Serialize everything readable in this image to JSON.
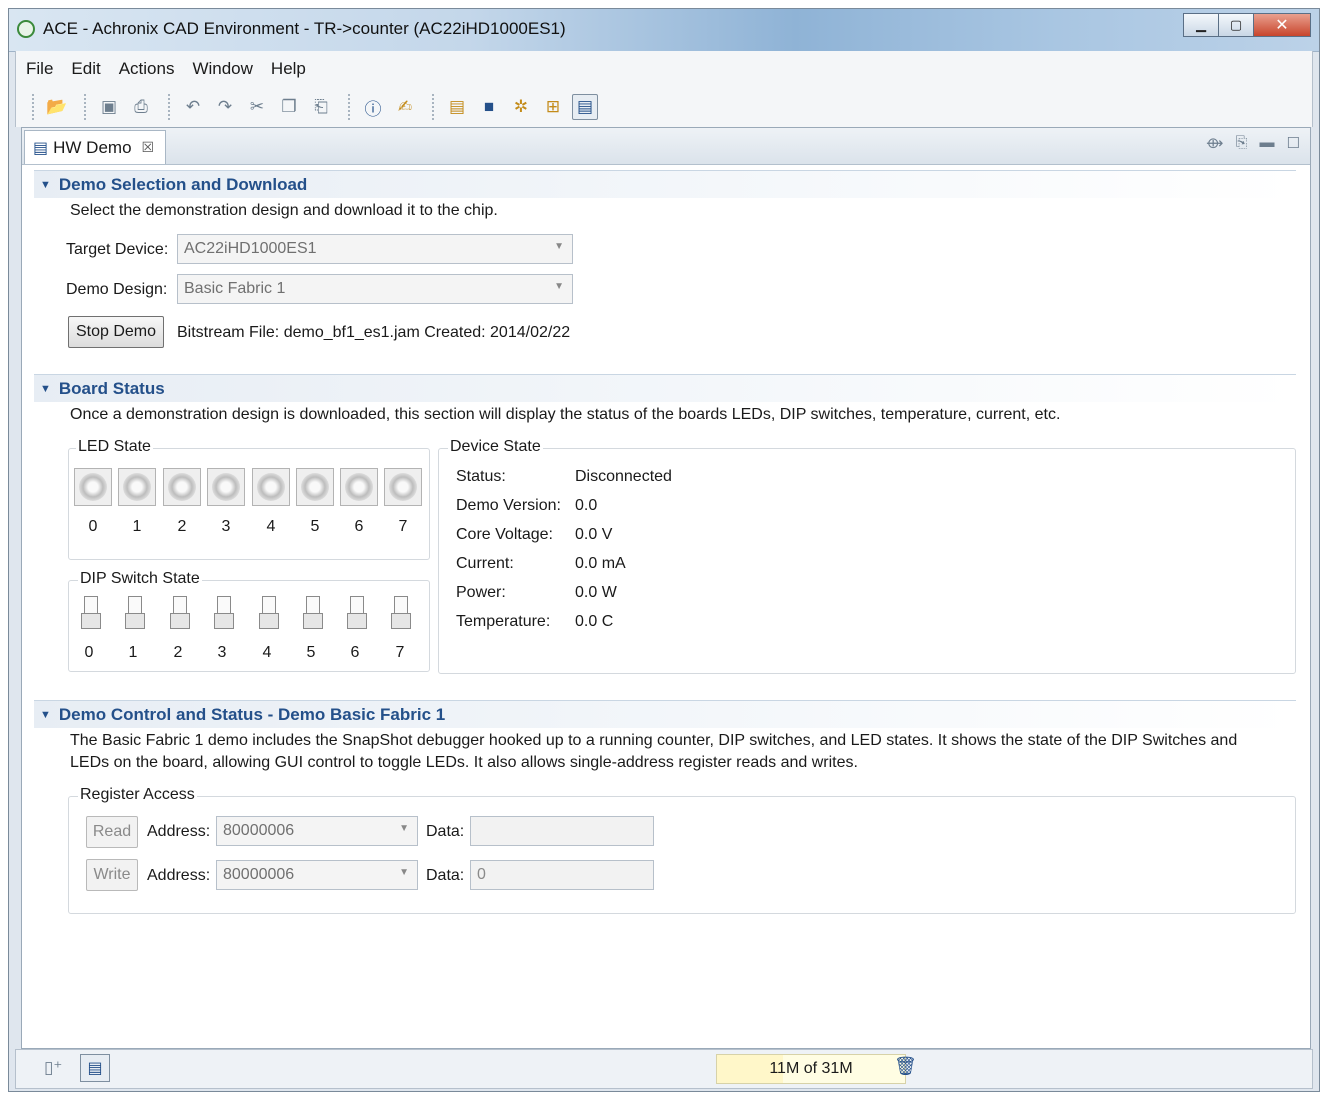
{
  "window": {
    "title": "ACE - Achronix CAD Environment - TR->counter (AC22iHD1000ES1)",
    "minimize": "▁",
    "maximize": "▢",
    "close": "✕"
  },
  "menu": [
    "File",
    "Edit",
    "Actions",
    "Window",
    "Help"
  ],
  "toolbar_icons": [
    "open-folder-icon",
    "save-icon",
    "print-icon",
    "undo-icon",
    "redo-icon",
    "cut-icon",
    "copy-icon",
    "paste-icon",
    "help-icon",
    "cheat-sheet-icon",
    "project-icon",
    "chip-icon",
    "gear-icon",
    "flow-icon",
    "hw-demo-icon"
  ],
  "view": {
    "tab_label": "HW Demo",
    "tab_close": "☒"
  },
  "demo_selection": {
    "title": "Demo Selection and Download",
    "description": "Select the demonstration design and download it to the chip.",
    "target_device_label": "Target Device:",
    "target_device_value": "AC22iHD1000ES1",
    "demo_design_label": "Demo Design:",
    "demo_design_value": "Basic Fabric 1",
    "stop_button": "Stop Demo",
    "bitstream_info": "Bitstream File: demo_bf1_es1.jam  Created: 2014/02/22"
  },
  "board_status": {
    "title": "Board Status",
    "description": "Once a demonstration design is downloaded, this section will display the status of the boards LEDs, DIP switches, temperature, current, etc.",
    "led_group_label": "LED State",
    "led_numbers": [
      "0",
      "1",
      "2",
      "3",
      "4",
      "5",
      "6",
      "7"
    ],
    "dip_group_label": "DIP Switch State",
    "dip_numbers": [
      "0",
      "1",
      "2",
      "3",
      "4",
      "5",
      "6",
      "7"
    ],
    "device_group_label": "Device State",
    "device_rows": [
      {
        "label": "Status:",
        "value": "Disconnected"
      },
      {
        "label": "Demo Version:",
        "value": "0.0"
      },
      {
        "label": "Core Voltage:",
        "value": "0.0 V"
      },
      {
        "label": "Current:",
        "value": "0.0 mA"
      },
      {
        "label": "Power:",
        "value": "0.0 W"
      },
      {
        "label": "Temperature:",
        "value": "0.0 C"
      }
    ]
  },
  "demo_control": {
    "title": "Demo Control and Status - Demo Basic Fabric 1",
    "description_line1": "The Basic Fabric 1 demo includes the SnapShot debugger hooked up to a running counter, DIP switches, and LED states.  It shows the state of the DIP Switches and",
    "description_line2": "LEDs on the board, allowing GUI control to toggle LEDs.  It also allows single-address register reads and writes.",
    "register_group_label": "Register Access",
    "read_button": "Read",
    "write_button": "Write",
    "address_label": "Address:",
    "data_label": "Data:",
    "read_address": "80000006",
    "read_data": "",
    "write_address": "80000006",
    "write_data": "0"
  },
  "status": {
    "heap": "11M of 31M",
    "heap_used_fraction": 0.35
  }
}
